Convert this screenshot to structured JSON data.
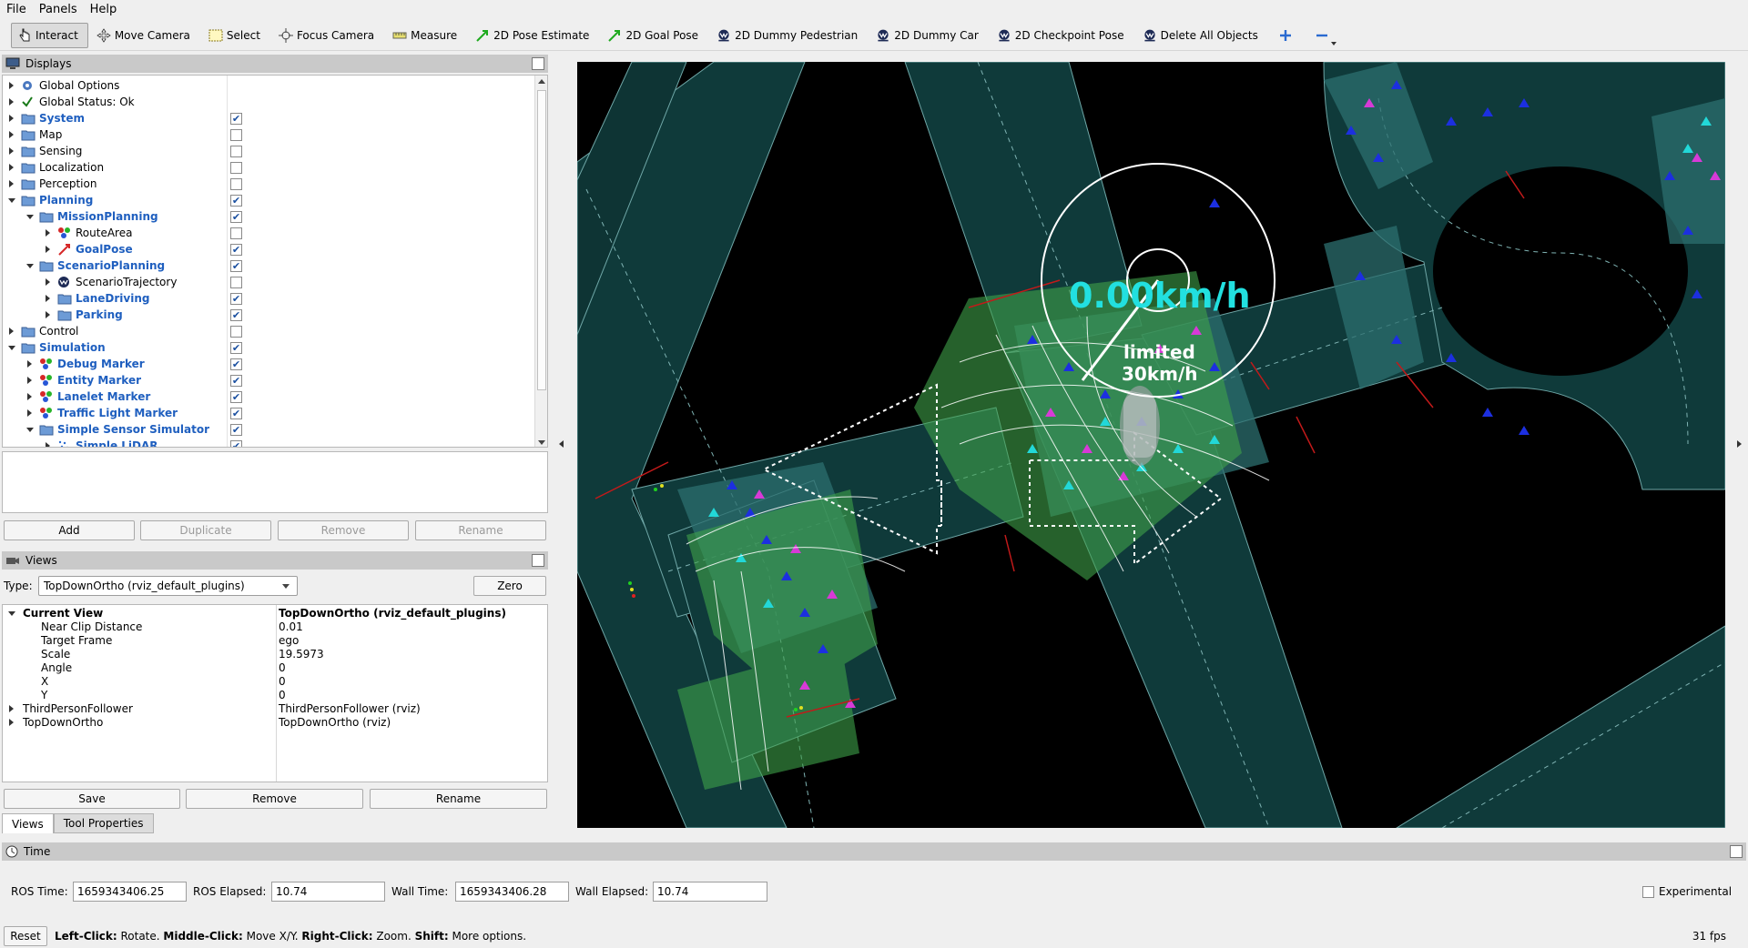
{
  "menu": {
    "file": "File",
    "panels": "Panels",
    "help": "Help"
  },
  "toolbar": {
    "interact": "Interact",
    "move_camera": "Move Camera",
    "select": "Select",
    "focus_camera": "Focus Camera",
    "measure": "Measure",
    "pose_estimate": "2D Pose Estimate",
    "goal_pose": "2D Goal Pose",
    "dummy_pedestrian": "2D Dummy Pedestrian",
    "dummy_car": "2D Dummy Car",
    "checkpoint_pose": "2D Checkpoint Pose",
    "delete_all": "Delete All Objects"
  },
  "displays": {
    "title": "Displays",
    "items": [
      {
        "label": "Global Options",
        "indent": 0,
        "expand": "right",
        "icon": "gear-icon",
        "blue": false,
        "checkbox": null
      },
      {
        "label": "Global Status: Ok",
        "indent": 0,
        "expand": "right",
        "icon": "checkmark-icon",
        "blue": false,
        "checkbox": null
      },
      {
        "label": "System",
        "indent": 0,
        "expand": "right",
        "icon": "folder-icon",
        "blue": true,
        "checkbox": true
      },
      {
        "label": "Map",
        "indent": 0,
        "expand": "right",
        "icon": "folder-icon",
        "blue": false,
        "checkbox": false
      },
      {
        "label": "Sensing",
        "indent": 0,
        "expand": "right",
        "icon": "folder-icon",
        "blue": false,
        "checkbox": false
      },
      {
        "label": "Localization",
        "indent": 0,
        "expand": "right",
        "icon": "folder-icon",
        "blue": false,
        "checkbox": false
      },
      {
        "label": "Perception",
        "indent": 0,
        "expand": "right",
        "icon": "folder-icon",
        "blue": false,
        "checkbox": false
      },
      {
        "label": "Planning",
        "indent": 0,
        "expand": "down",
        "icon": "folder-icon",
        "blue": true,
        "checkbox": true
      },
      {
        "label": "MissionPlanning",
        "indent": 1,
        "expand": "down",
        "icon": "folder-icon",
        "blue": true,
        "checkbox": true
      },
      {
        "label": "RouteArea",
        "indent": 2,
        "expand": "right",
        "icon": "marker-icon",
        "blue": false,
        "checkbox": false
      },
      {
        "label": "GoalPose",
        "indent": 2,
        "expand": "right",
        "icon": "pose-arrow-icon",
        "blue": true,
        "checkbox": true
      },
      {
        "label": "ScenarioPlanning",
        "indent": 1,
        "expand": "down",
        "icon": "folder-icon",
        "blue": true,
        "checkbox": true
      },
      {
        "label": "ScenarioTrajectory",
        "indent": 2,
        "expand": "right",
        "icon": "autoware-icon",
        "blue": false,
        "checkbox": false
      },
      {
        "label": "LaneDriving",
        "indent": 2,
        "expand": "right",
        "icon": "folder-icon",
        "blue": true,
        "checkbox": true
      },
      {
        "label": "Parking",
        "indent": 2,
        "expand": "right",
        "icon": "folder-icon",
        "blue": true,
        "checkbox": true
      },
      {
        "label": "Control",
        "indent": 0,
        "expand": "right",
        "icon": "folder-icon",
        "blue": false,
        "checkbox": false
      },
      {
        "label": "Simulation",
        "indent": 0,
        "expand": "down",
        "icon": "folder-icon",
        "blue": true,
        "checkbox": true
      },
      {
        "label": "Debug Marker",
        "indent": 1,
        "expand": "right",
        "icon": "marker-icon",
        "blue": true,
        "checkbox": true
      },
      {
        "label": "Entity Marker",
        "indent": 1,
        "expand": "right",
        "icon": "marker-icon",
        "blue": true,
        "checkbox": true
      },
      {
        "label": "Lanelet Marker",
        "indent": 1,
        "expand": "right",
        "icon": "marker-icon",
        "blue": true,
        "checkbox": true
      },
      {
        "label": "Traffic Light Marker",
        "indent": 1,
        "expand": "right",
        "icon": "marker-icon",
        "blue": true,
        "checkbox": true
      },
      {
        "label": "Simple Sensor Simulator",
        "indent": 1,
        "expand": "down",
        "icon": "folder-icon",
        "blue": true,
        "checkbox": true
      },
      {
        "label": "Simple LiDAR",
        "indent": 2,
        "expand": "right",
        "icon": "pointcloud-icon",
        "blue": true,
        "checkbox": true
      }
    ],
    "buttons": {
      "add": "Add",
      "duplicate": "Duplicate",
      "remove": "Remove",
      "rename": "Rename"
    }
  },
  "views": {
    "title": "Views",
    "type_label": "Type:",
    "type_value": "TopDownOrtho (rviz_default_plugins)",
    "zero": "Zero",
    "props": [
      {
        "name": "Current View",
        "value": "TopDownOrtho (rviz_default_plugins)",
        "indent": 0,
        "bold": true,
        "expand": "down"
      },
      {
        "name": "Near Clip Distance",
        "value": "0.01",
        "indent": 1,
        "bold": false,
        "expand": null
      },
      {
        "name": "Target Frame",
        "value": "ego",
        "indent": 1,
        "bold": false,
        "expand": null
      },
      {
        "name": "Scale",
        "value": "19.5973",
        "indent": 1,
        "bold": false,
        "expand": null
      },
      {
        "name": "Angle",
        "value": "0",
        "indent": 1,
        "bold": false,
        "expand": null
      },
      {
        "name": "X",
        "value": "0",
        "indent": 1,
        "bold": false,
        "expand": null
      },
      {
        "name": "Y",
        "value": "0",
        "indent": 1,
        "bold": false,
        "expand": null
      },
      {
        "name": "ThirdPersonFollower",
        "value": "ThirdPersonFollower (rviz)",
        "indent": 0,
        "bold": false,
        "expand": "right"
      },
      {
        "name": "TopDownOrtho",
        "value": "TopDownOrtho (rviz)",
        "indent": 0,
        "bold": false,
        "expand": "right"
      }
    ],
    "buttons": {
      "save": "Save",
      "remove": "Remove",
      "rename": "Rename"
    },
    "tabs": {
      "views": "Views",
      "tool_properties": "Tool Properties"
    }
  },
  "viewport": {
    "speed": "0.00km/h",
    "limit_line1": "limited",
    "limit_line2": "30km/h",
    "colors": {
      "road": "#0f3a3a",
      "lane_fill": "#2c6f6f",
      "green": "#3fa24a",
      "blue_arrow": "#1c2fe0",
      "magenta_arrow": "#d73ad7",
      "cyan_arrow": "#22d8d8",
      "speed_text": "#22e0e0"
    }
  },
  "time": {
    "title": "Time",
    "ros_time_label": "ROS Time:",
    "ros_time": "1659343406.25",
    "ros_elapsed_label": "ROS Elapsed:",
    "ros_elapsed": "10.74",
    "wall_time_label": "Wall Time:",
    "wall_time": "1659343406.28",
    "wall_elapsed_label": "Wall Elapsed:",
    "wall_elapsed": "10.74",
    "experimental": "Experimental"
  },
  "status": {
    "reset": "Reset",
    "hint_left": "Left-Click:",
    "hint_left_desc": " Rotate. ",
    "hint_middle": "Middle-Click:",
    "hint_middle_desc": " Move X/Y. ",
    "hint_right": "Right-Click:",
    "hint_right_desc": " Zoom. ",
    "hint_shift": "Shift:",
    "hint_shift_desc": " More options.",
    "fps": "31 fps"
  }
}
